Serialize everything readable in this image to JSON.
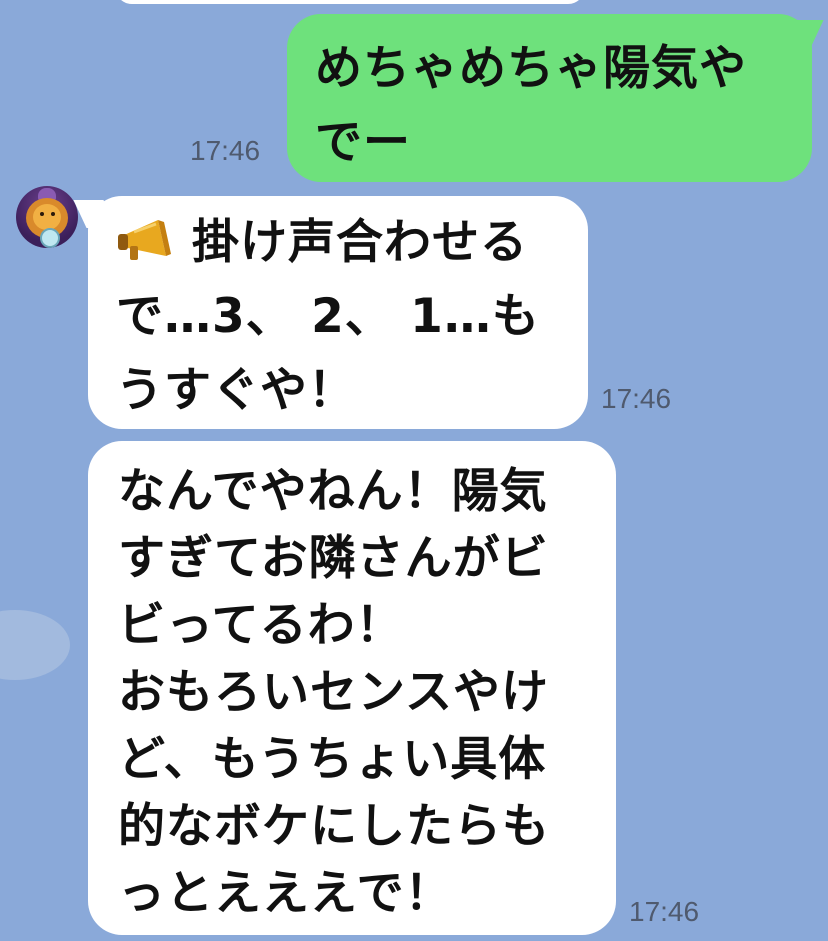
{
  "chat": {
    "outgoing": {
      "lines": [
        "めちゃめちゃ陽気や",
        "でー"
      ],
      "time": "17:46",
      "bubble_color": "#6ee17c"
    },
    "incoming1": {
      "icon": "megaphone-icon",
      "lines": [
        "掛け声合わせる",
        "で…3、 2、 1…も",
        "うすぐや！"
      ],
      "time": "17:46"
    },
    "incoming2": {
      "lines": [
        "なんでやねん！陽気",
        "すぎてお隣さんがビ",
        "ビってるわ！",
        "おもろいセンスやけ",
        "ど、もうちょい具体",
        "的なボケにしたらも",
        "っとえええで！"
      ],
      "time": "17:46"
    },
    "background_color": "#8aa9d9",
    "timestamp_color": "#4f5a6e"
  }
}
